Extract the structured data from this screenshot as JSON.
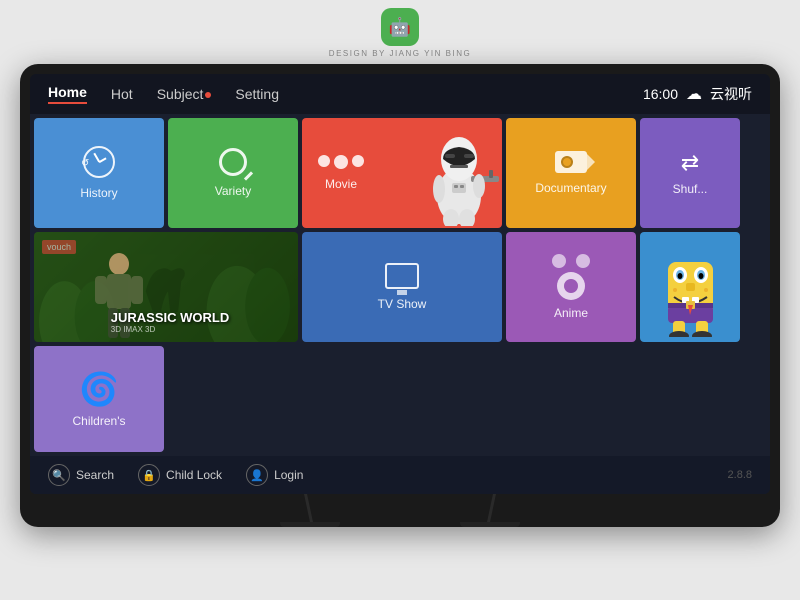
{
  "logo": {
    "icon": "🤖",
    "subtitle": "DESIGN BY JIANG YIN BING"
  },
  "nav": {
    "items": [
      {
        "label": "Home",
        "active": true
      },
      {
        "label": "Hot",
        "active": false
      },
      {
        "label": "Subject",
        "active": false,
        "dot": true
      },
      {
        "label": "Setting",
        "active": false
      }
    ],
    "time": "16:00",
    "brand": "云视听"
  },
  "tiles": {
    "history": {
      "label": "History"
    },
    "variety": {
      "label": "Variety"
    },
    "movie": {
      "label": "Movie"
    },
    "documentary": {
      "label": "Documentary"
    },
    "shuffle": {
      "label": "Shuf..."
    },
    "jurassic": {
      "badge": "vouch",
      "title": "JURASSIC WORLD",
      "subtitle": "3D IMAX 3D"
    },
    "tvshow": {
      "label": "TV Show"
    },
    "anime": {
      "label": "Anime"
    },
    "children": {
      "label": "Children's"
    }
  },
  "bottomBar": {
    "search": "Search",
    "childLock": "Child Lock",
    "login": "Login",
    "version": "2.8.8"
  }
}
